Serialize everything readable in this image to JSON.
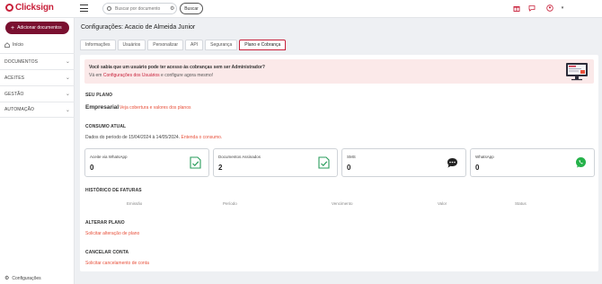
{
  "brand": {
    "name": "Clicksign",
    "color": "#c8203a"
  },
  "topbar": {
    "search_placeholder": "Buscar por documento",
    "search_button": "Buscar",
    "icons": [
      "menu-icon",
      "search-icon",
      "filter-icon",
      "gift-icon",
      "chat-icon",
      "user-icon",
      "caret-down-icon"
    ]
  },
  "sidebar": {
    "add_button": "Adicionar documentos",
    "home": "Início",
    "sections": [
      "DOCUMENTOS",
      "ACEITES",
      "GESTÃO",
      "AUTOMAÇÃO"
    ],
    "config": "Configurações"
  },
  "page": {
    "title": "Configurações: Acacio de Almeida Junior",
    "tabs": [
      "Informações",
      "Usuários",
      "Personalizar",
      "API",
      "Segurança",
      "Plano e Cobrança"
    ],
    "active_tab": "Plano e Cobrança"
  },
  "banner": {
    "title": "Você sabia que um usuário pode ter acesso às cobranças sem ser Administrador?",
    "text_prefix": "Vá em",
    "text_link": "Configurações dos Usuários",
    "text_suffix": "e configure agora mesmo!"
  },
  "plan": {
    "section_title": "SEU PLANO",
    "name": "Empresarial",
    "link": "Veja cobertura e valores dos planos"
  },
  "consumption": {
    "section_title": "CONSUMO ATUAL",
    "period_text": "Dados do período de 15/04/2024 à 14/05/2024.",
    "period_link": "Entenda o consumo.",
    "cards": [
      {
        "label": "Aceite via WhatsApp",
        "value": "0",
        "icon": "document-check-icon"
      },
      {
        "label": "Documentos Assinados",
        "value": "2",
        "icon": "document-check-icon"
      },
      {
        "label": "SMS",
        "value": "0",
        "icon": "sms-icon"
      },
      {
        "label": "WhatsApp",
        "value": "0",
        "icon": "whatsapp-icon"
      }
    ]
  },
  "invoices": {
    "section_title": "HISTÓRICO DE FATURAS",
    "columns": [
      "Emissão",
      "Período",
      "Vencimento",
      "Valor",
      "Status"
    ]
  },
  "change_plan": {
    "section_title": "ALTERAR PLANO",
    "link": "Solicitar alteração de plano"
  },
  "cancel": {
    "section_title": "CANCELAR CONTA",
    "link": "Solicitar cancelamento de conta"
  }
}
